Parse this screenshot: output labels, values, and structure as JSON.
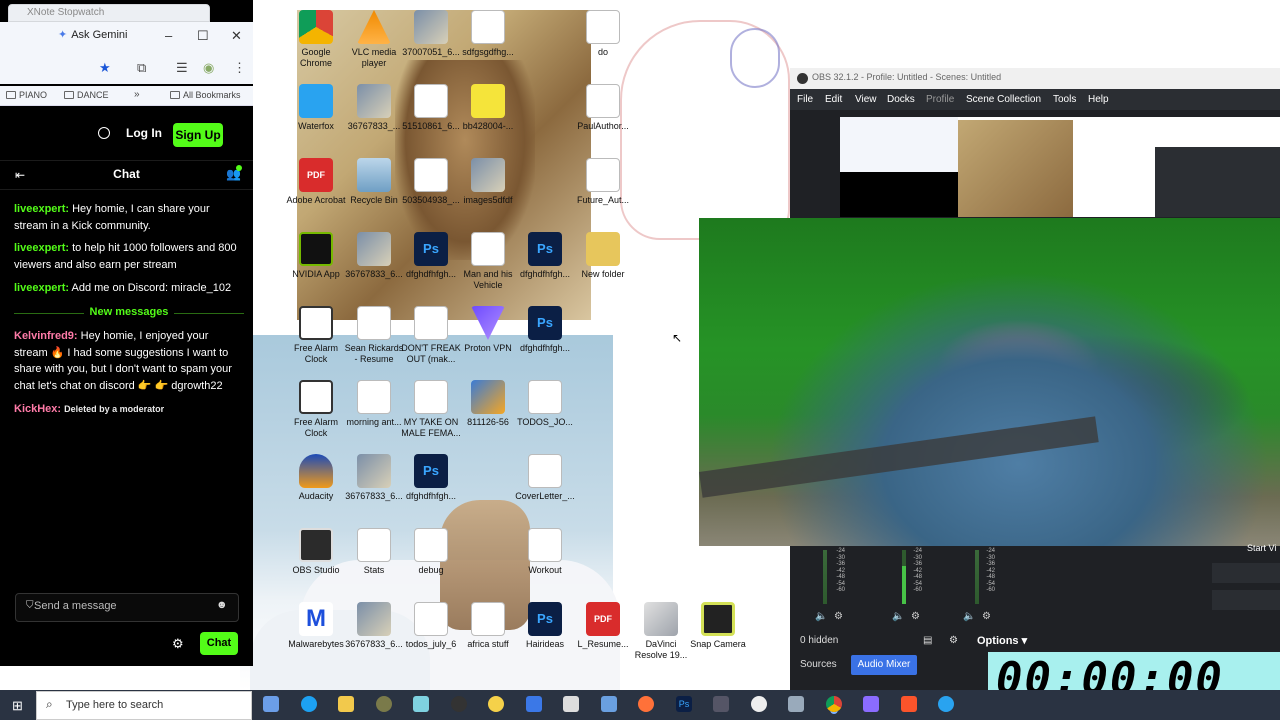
{
  "browser": {
    "prev_tab": "XNote Stopwatch",
    "ask_gemini": "Ask Gemini",
    "bookmarks": [
      "PIANO",
      "DANCE",
      "All Bookmarks"
    ],
    "login": "Log In",
    "signup": "Sign Up",
    "chat_title": "Chat",
    "messages": [
      {
        "user": "liveexpert:",
        "text": "Hey homie, I can share your stream in a Kick community."
      },
      {
        "user": "liveexpert:",
        "text": "to help hit 1000 followers and 800 viewers and also earn per stream"
      },
      {
        "user": "liveexpert:",
        "text": "Add me on Discord: miracle_102"
      }
    ],
    "new_messages": "New messages",
    "new_msgs": [
      {
        "user": "Kelvinfred9:",
        "text": "Hey homie, I enjoyed your stream 🔥 I had some suggestions I want to share with you, but I don't want to spam your chat let's chat on discord 👉 👉 dgrowth22"
      },
      {
        "user": "KickHex:",
        "text": "Deleted by a moderator"
      }
    ],
    "send_placeholder": "Send a message",
    "chat_button": "Chat"
  },
  "desktop_icons": [
    {
      "label": "Google Chrome"
    },
    {
      "label": "VLC media player"
    },
    {
      "label": "37007051_6..."
    },
    {
      "label": "sdfgsgdfhg..."
    },
    {
      "label": "do"
    },
    {
      "label": "Waterfox"
    },
    {
      "label": "36767833_..."
    },
    {
      "label": "51510861_6..."
    },
    {
      "label": "bb428004-..."
    },
    {
      "label": "PaulAuthor..."
    },
    {
      "label": "Adobe Acrobat"
    },
    {
      "label": "Recycle Bin"
    },
    {
      "label": "503504938_..."
    },
    {
      "label": "images5dfdf"
    },
    {
      "label": "Future_Aut..."
    },
    {
      "label": "NVIDIA App"
    },
    {
      "label": "36767833_6..."
    },
    {
      "label": "dfghdfhfgh..."
    },
    {
      "label": "Man and his Vehicle"
    },
    {
      "label": "dfghdfhfgh..."
    },
    {
      "label": "New folder"
    },
    {
      "label": "Free Alarm Clock"
    },
    {
      "label": "Sean Rickards - Resume"
    },
    {
      "label": "DON'T FREAK OUT (mak..."
    },
    {
      "label": "Proton VPN"
    },
    {
      "label": "dfghdfhfgh..."
    },
    {
      "label": "Free Alarm Clock"
    },
    {
      "label": "morning ant..."
    },
    {
      "label": "MY TAKE ON MALE FEMA..."
    },
    {
      "label": "811126-56"
    },
    {
      "label": "TODOS_JO..."
    },
    {
      "label": "Audacity"
    },
    {
      "label": "36767833_6..."
    },
    {
      "label": "dfghdfhfgh..."
    },
    {
      "label": "CoverLetter_..."
    },
    {
      "label": "OBS Studio"
    },
    {
      "label": "Stats"
    },
    {
      "label": "debug"
    },
    {
      "label": "Workout"
    },
    {
      "label": "Malwarebytes"
    },
    {
      "label": "36767833_6..."
    },
    {
      "label": "todos_july_6"
    },
    {
      "label": "africa stuff"
    },
    {
      "label": "Hairideas"
    },
    {
      "label": "L_Resume..."
    },
    {
      "label": "DaVinci Resolve 19..."
    },
    {
      "label": "Snap Camera"
    }
  ],
  "obs": {
    "title": "OBS 32.1.2 - Profile: Untitled - Scenes: Untitled",
    "menu": [
      "File",
      "Edit",
      "View",
      "Docks",
      "Profile",
      "Scene Collection",
      "Tools",
      "Help"
    ],
    "meter_ticks": [
      "-24",
      "-30",
      "-36",
      "-42",
      "-48",
      "-54",
      "-60"
    ],
    "hidden": "0 hidden",
    "options": "Options",
    "tab_sources": "Sources",
    "tab_mixer": "Audio Mixer",
    "start_label": "Start Vi"
  },
  "stopwatch": "00:00:00",
  "taskbar": {
    "search_placeholder": "Type here to search"
  },
  "colors": {
    "kick_green": "#53fc18",
    "chat_bg": "#000000",
    "obs_bg": "#1f2125",
    "obs_accent": "#3a72e6",
    "taskbar": "#2a3342"
  }
}
